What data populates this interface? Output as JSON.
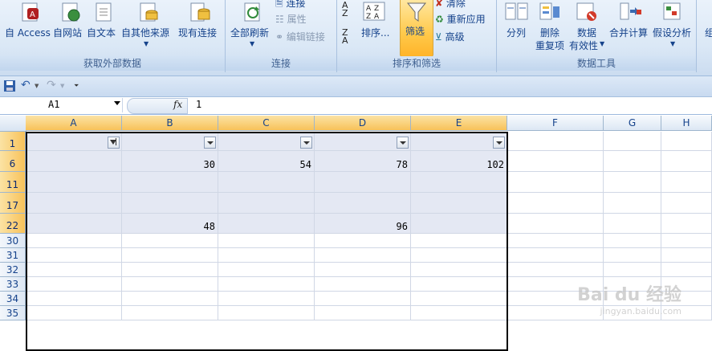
{
  "ribbon": {
    "get_external": {
      "label": "获取外部数据",
      "buttons": [
        "自 Access",
        "自网站",
        "自文本",
        "自其他来源",
        "现有连接"
      ]
    },
    "connections": {
      "label": "连接",
      "refresh_all": "全部刷新",
      "connect": "连接",
      "properties": "属性",
      "edit_links": "编辑链接"
    },
    "sort_filter": {
      "label": "排序和筛选",
      "sort": "排序...",
      "filter": "筛选",
      "clear": "清除",
      "reapply": "重新应用",
      "advanced": "高级"
    },
    "data_tools": {
      "label": "数据工具",
      "split": "分列",
      "remove_dup_1": "删除",
      "remove_dup_2": "重复项",
      "validation_1": "数据",
      "validation_2": "有效性",
      "consolidate": "合并计算",
      "what_if": "假设分析"
    },
    "outline_partial": "组"
  },
  "formula_bar": {
    "name_box": "A1",
    "fx": "fx",
    "content": "1"
  },
  "columns": [
    "A",
    "B",
    "C",
    "D",
    "E",
    "F",
    "G",
    "H"
  ],
  "rows": [
    {
      "num": "1",
      "cells": [
        "",
        "",
        "",
        "",
        ""
      ]
    },
    {
      "num": "6",
      "cells": [
        "",
        "30",
        "54",
        "78",
        "102"
      ]
    },
    {
      "num": "11",
      "cells": [
        "",
        "",
        "",
        "",
        ""
      ]
    },
    {
      "num": "17",
      "cells": [
        "",
        "",
        "",
        "",
        ""
      ]
    },
    {
      "num": "22",
      "cells": [
        "",
        "48",
        "",
        "96",
        ""
      ]
    },
    {
      "num": "30",
      "cells": [
        "",
        "",
        "",
        "",
        ""
      ]
    },
    {
      "num": "31",
      "cells": [
        "",
        "",
        "",
        "",
        ""
      ]
    },
    {
      "num": "32",
      "cells": [
        "",
        "",
        "",
        "",
        ""
      ]
    },
    {
      "num": "33",
      "cells": [
        "",
        "",
        "",
        "",
        ""
      ]
    },
    {
      "num": "34",
      "cells": [
        "",
        "",
        "",
        "",
        ""
      ]
    },
    {
      "num": "35",
      "cells": [
        "",
        "",
        "",
        "",
        ""
      ]
    }
  ],
  "colors": {
    "selected_header": "#f8c25a",
    "filtered_range": "#e4e8f3",
    "row_number_selected": "#15428b"
  },
  "watermark": {
    "main": "Bai du 经验",
    "sub": "jingyan.baidu.com"
  }
}
